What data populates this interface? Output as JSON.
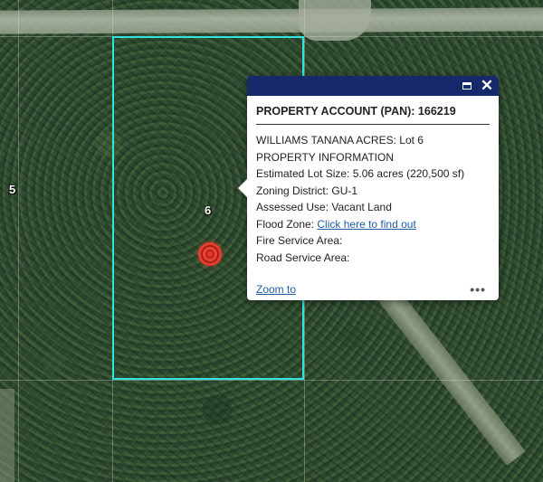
{
  "map": {
    "lot_labels": {
      "west": "5",
      "center": "6"
    },
    "parcel_outline_color": "#33e3e0",
    "marker_icon": "location-target-icon"
  },
  "popup": {
    "header_color": "#16296a",
    "maximize_icon": "maximize-icon",
    "close_icon": "close-icon",
    "title": "PROPERTY ACCOUNT (PAN): 166219",
    "subdivision": "WILLIAMS TANANA ACRES: Lot 6",
    "section_heading": "PROPERTY INFORMATION",
    "lot_size": "Estimated Lot Size: 5.06 acres (220,500 sf)",
    "zoning": "Zoning District: GU-1",
    "assessed_use": "Assessed Use: Vacant Land",
    "flood_zone_label": "Flood Zone:",
    "flood_zone_link": "Click here to find out",
    "fire_service": "Fire Service Area:",
    "road_service": "Road Service Area:",
    "zoom_to": "Zoom to",
    "more_icon": "more-options-icon"
  }
}
